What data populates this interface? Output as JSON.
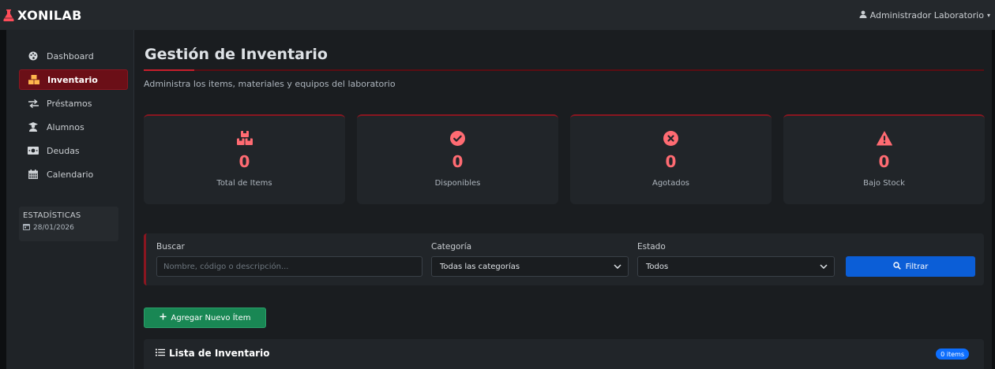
{
  "app": {
    "brand": "XONILAB",
    "user_name": "Administrador Laboratorio"
  },
  "sidebar": {
    "items": [
      {
        "label": "Dashboard",
        "icon": "palette-icon",
        "active": false
      },
      {
        "label": "Inventario",
        "icon": "boxes-icon",
        "active": true
      },
      {
        "label": "Préstamos",
        "icon": "exchange-icon",
        "active": false
      },
      {
        "label": "Alumnos",
        "icon": "graduate-icon",
        "active": false
      },
      {
        "label": "Deudas",
        "icon": "money-icon",
        "active": false
      },
      {
        "label": "Calendario",
        "icon": "calendar-icon",
        "active": false
      }
    ],
    "stats_title": "ESTADÍSTICAS",
    "stats_date": "28/01/2026"
  },
  "page": {
    "title": "Gestión de Inventario",
    "subtitle": "Administra los items, materiales y equipos del laboratorio"
  },
  "cards": [
    {
      "icon": "boxes-icon",
      "value": "0",
      "label": "Total de Items"
    },
    {
      "icon": "check-circle-icon",
      "value": "0",
      "label": "Disponibles"
    },
    {
      "icon": "x-circle-icon",
      "value": "0",
      "label": "Agotados"
    },
    {
      "icon": "warning-icon",
      "value": "0",
      "label": "Bajo Stock"
    }
  ],
  "filters": {
    "search_label": "Buscar",
    "search_placeholder": "Nombre, código o descripción...",
    "search_value": "",
    "category_label": "Categoría",
    "category_value": "Todas las categorías",
    "status_label": "Estado",
    "status_value": "Todos",
    "filter_button": "Filtrar"
  },
  "actions": {
    "add_button": "Agregar Nuevo Ítem"
  },
  "list": {
    "title": "Lista de Inventario",
    "count_badge": "0 items"
  },
  "colors": {
    "accent_red": "#c81e2b",
    "stat_red": "#ff6b72",
    "primary_blue": "#0b5ed7",
    "success_green": "#198754"
  }
}
